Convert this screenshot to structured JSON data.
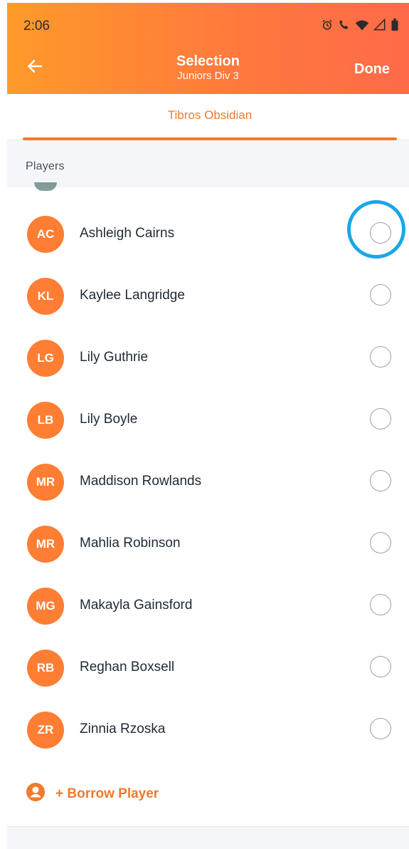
{
  "status_bar": {
    "time": "2:06"
  },
  "header": {
    "title": "Selection",
    "subtitle": "Juniors Div 3",
    "done_label": "Done"
  },
  "tabs": [
    {
      "label": "Tibros Obsidian",
      "active": true
    }
  ],
  "section": {
    "title": "Players"
  },
  "players": [
    {
      "initials": "AC",
      "name": "Ashleigh Cairns",
      "selected": false,
      "highlighted": true
    },
    {
      "initials": "KL",
      "name": "Kaylee Langridge",
      "selected": false
    },
    {
      "initials": "LG",
      "name": "Lily Guthrie",
      "selected": false
    },
    {
      "initials": "LB",
      "name": "Lily Boyle",
      "selected": false
    },
    {
      "initials": "MR",
      "name": "Maddison Rowlands",
      "selected": false
    },
    {
      "initials": "MR",
      "name": "Mahlia Robinson",
      "selected": false
    },
    {
      "initials": "MG",
      "name": "Makayla Gainsford",
      "selected": false
    },
    {
      "initials": "RB",
      "name": "Reghan Boxsell",
      "selected": false
    },
    {
      "initials": "ZR",
      "name": "Zinnia Rzoska",
      "selected": false
    }
  ],
  "borrow": {
    "label": "+ Borrow Player"
  },
  "colors": {
    "accent": "#F07A2E",
    "avatar": "#FF7E33",
    "highlight": "#1AA7E6",
    "header_start": "#FF9A2A",
    "header_end": "#FF6A4A"
  },
  "icons": {
    "back": "arrow-left-icon",
    "alarm": "alarm-icon",
    "call": "wifi-call-icon",
    "wifi": "wifi-icon",
    "signal": "signal-icon",
    "battery": "battery-icon",
    "borrow": "user-circle-icon"
  }
}
